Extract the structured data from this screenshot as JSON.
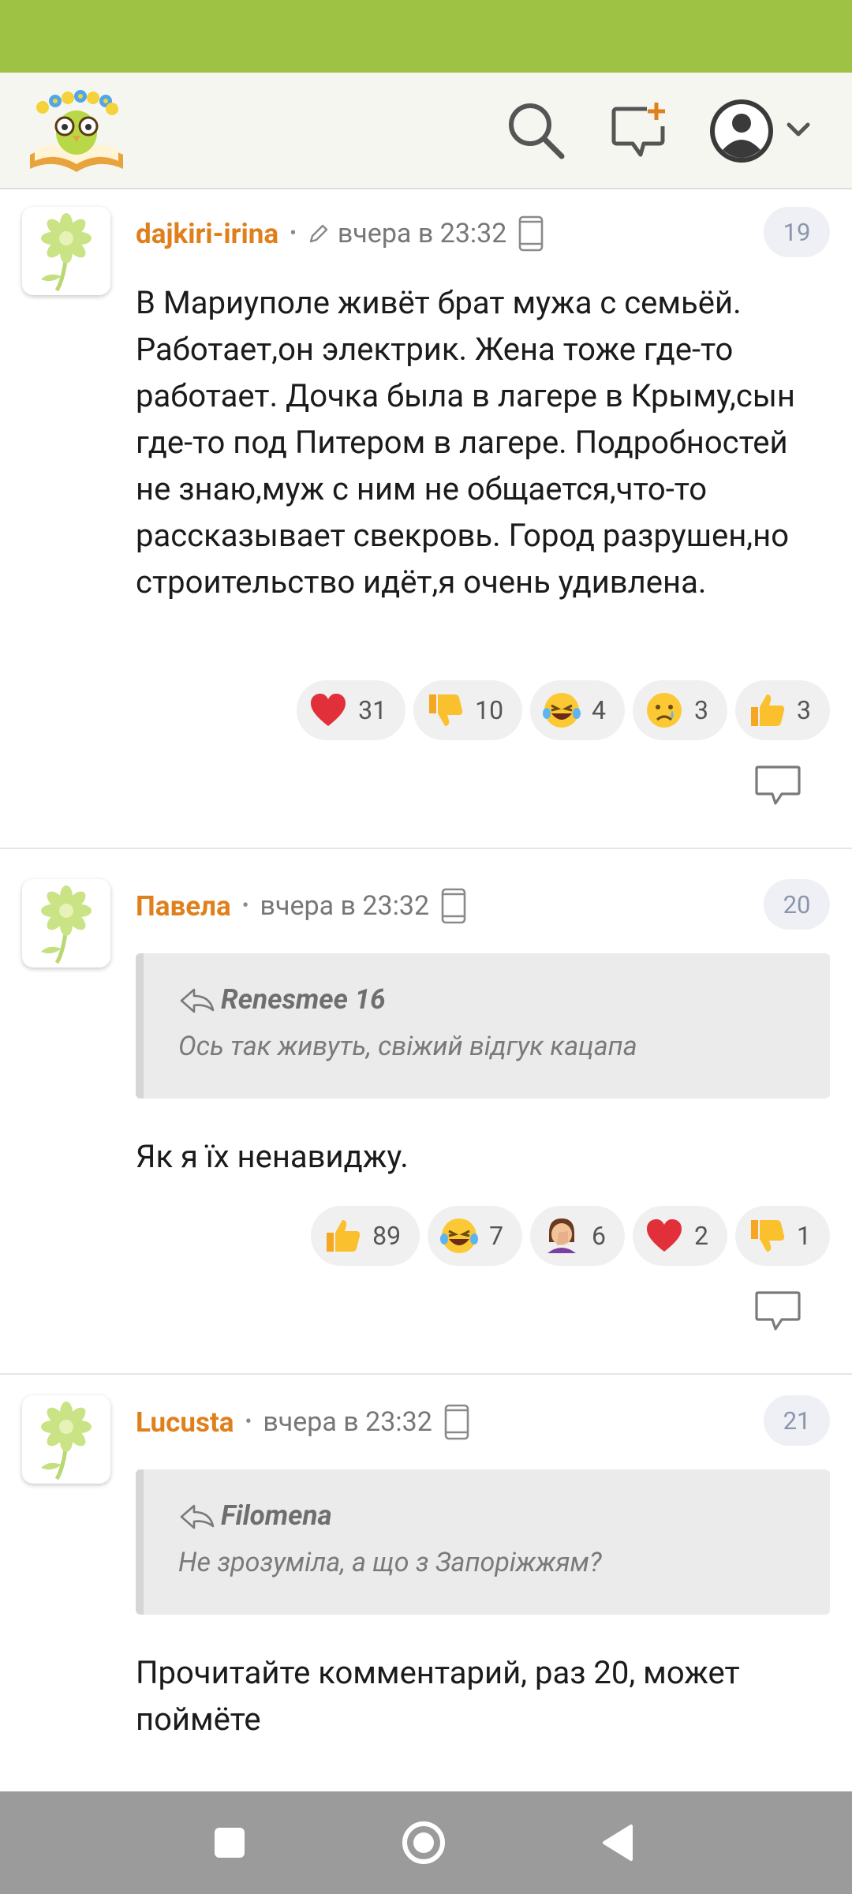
{
  "header": {
    "logo": "book-owl-logo",
    "icons": [
      "search-icon",
      "new-post-icon",
      "user-avatar-icon",
      "chevron-down-icon"
    ]
  },
  "comments": [
    {
      "author": "dajkiri-irina",
      "edited_icon": "pencil-icon",
      "time": "вчера в 23:32",
      "device_icon": "phone-icon",
      "number": "19",
      "text": "В Мариуполе живёт брат мужа с семьёй. Работает,он электрик. Жена тоже где-то работает. Дочка была в лагере в Крыму,сын где-то под Питером в лагере. Подробностей не знаю,муж с ним не общается,что-то рассказывает свекровь. Город разрушен,но строительство идёт,я очень удивлена.",
      "reactions": [
        {
          "emoji": "heart",
          "count": "31"
        },
        {
          "emoji": "thumbs-down",
          "count": "10"
        },
        {
          "emoji": "tears-of-joy",
          "count": "4"
        },
        {
          "emoji": "crying-face",
          "count": "3"
        },
        {
          "emoji": "thumbs-up",
          "count": "3"
        }
      ]
    },
    {
      "author": "Павела",
      "time": "вчера в 23:32",
      "device_icon": "phone-icon",
      "number": "20",
      "quote": {
        "author": "Renesmee 16",
        "text": "Ось так живуть, свіжий відгук кацапа"
      },
      "text": "Як я їх ненавиджу.",
      "reactions": [
        {
          "emoji": "thumbs-up",
          "count": "89"
        },
        {
          "emoji": "tears-of-joy",
          "count": "7"
        },
        {
          "emoji": "facepalm",
          "count": "6"
        },
        {
          "emoji": "heart",
          "count": "2"
        },
        {
          "emoji": "thumbs-down",
          "count": "1"
        }
      ]
    },
    {
      "author": "Lucusta",
      "time": "вчера в 23:32",
      "device_icon": "phone-icon",
      "number": "21",
      "quote": {
        "author": "Filomena",
        "text": "Не зрозуміла, а що з Запоріжжям?"
      },
      "text": "Прочитайте комментарий, раз 20, может поймёте"
    }
  ],
  "colors": {
    "accent_green": "#9dc244",
    "author_orange": "#e0801c",
    "navbar_gray": "#9b9b9b"
  },
  "navbar": [
    "recent-apps-button",
    "home-button",
    "back-button"
  ]
}
